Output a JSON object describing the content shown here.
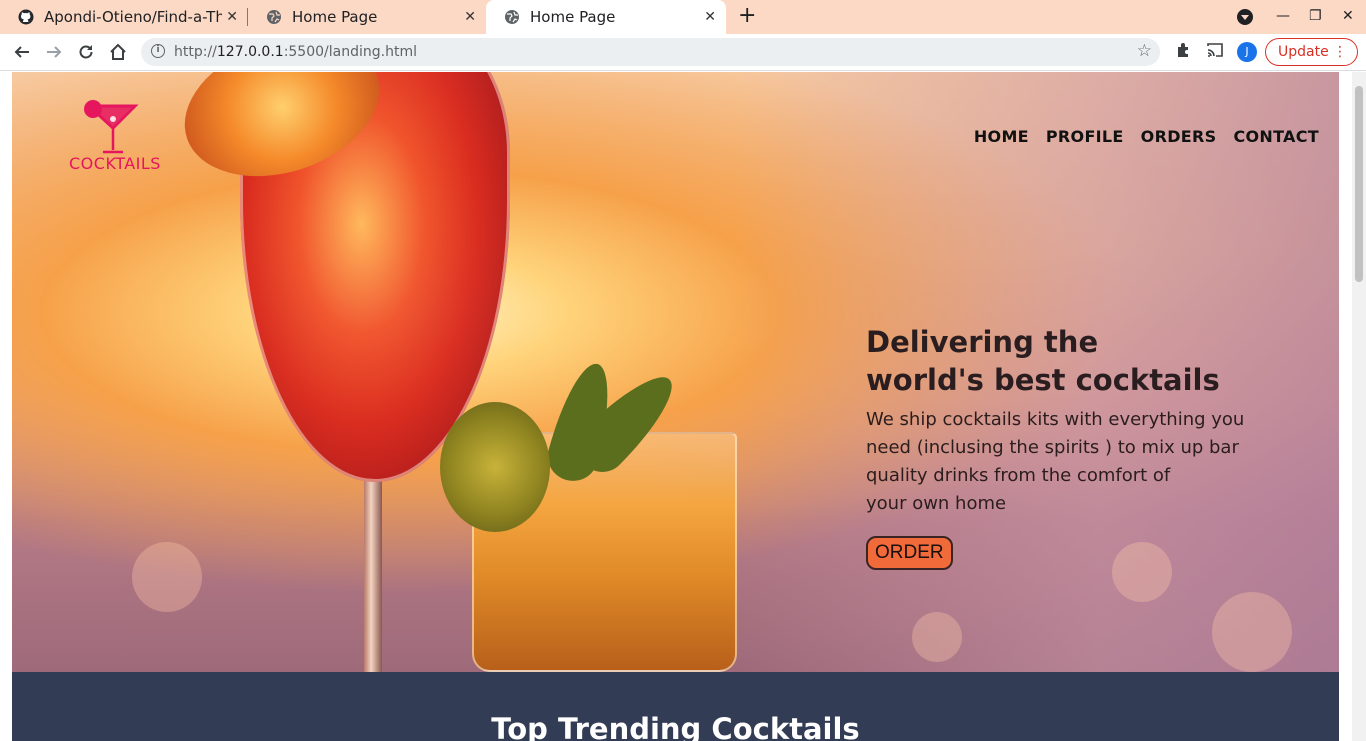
{
  "browser": {
    "tabs": [
      {
        "title": "Apondi-Otieno/Find-a-The",
        "icon": "github-icon",
        "active": false
      },
      {
        "title": "Home Page",
        "icon": "globe-icon",
        "active": false
      },
      {
        "title": "Home Page",
        "icon": "globe-icon",
        "active": true
      }
    ],
    "url_prefix": "http://",
    "url_host": "127.0.0.1",
    "url_rest": ":5500/landing.html",
    "update_label": "Update",
    "profile_initial": "J"
  },
  "page": {
    "logo_text": "COCKTAILS",
    "nav": [
      "HOME",
      "PROFILE",
      "ORDERS",
      "CONTACT"
    ],
    "hero": {
      "title_line1": "Delivering the",
      "title_line2": "world's best cocktails",
      "desc_line1": "We ship cocktails kits with everything you",
      "desc_line2": "need (inclusing the spirits ) to mix up bar",
      "desc_line3": "quality drinks from the comfort of",
      "desc_line4": "your own home",
      "order_label": "ORDER"
    },
    "section_title": "Top Trending Cocktails"
  },
  "colors": {
    "tabbar": "#fcd9c4",
    "logo": "#e5165e",
    "order_button": "#f06a3a",
    "section_bg": "#333c55",
    "update": "#d93025"
  }
}
